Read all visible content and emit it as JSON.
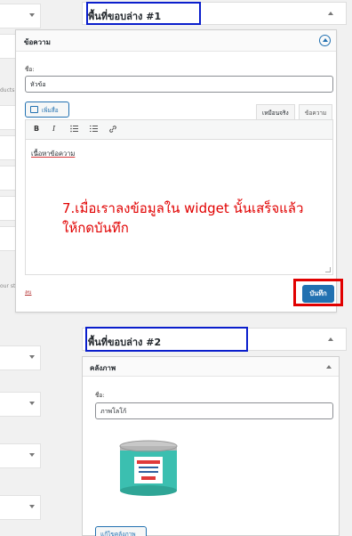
{
  "left_panel": {
    "fragments": [
      "ducts",
      "our st"
    ]
  },
  "area1": {
    "title": "พื้นที่ขอบล่าง #1"
  },
  "widget1": {
    "title": "ข้อความ",
    "title_field_label": "ชื่อ:",
    "title_field_value": "หัวข้อ",
    "add_media_label": "เพิ่มสื่อ",
    "tab_visual": "เหมือนจริง",
    "tab_text": "ข้อความ",
    "toolbar": {
      "bold": "B",
      "italic": "I"
    },
    "content": "เนื้อหาข้อความ",
    "delete_label": "ลบ",
    "save_label": "บันทึก"
  },
  "annotation": {
    "line1": "7.เมื่อเราลงข้อมูลใน widget นั้นเสร็จแล้ว",
    "line2": "ให้กดบันทึก"
  },
  "area2": {
    "title": "พื้นที่ขอบล่าง #2"
  },
  "widget2": {
    "title": "คลังภาพ",
    "title_field_label": "ชื่อ:",
    "title_field_value": "ภาพโลโก้",
    "edit_image_label": "แก้ไขคลังภาพ"
  }
}
